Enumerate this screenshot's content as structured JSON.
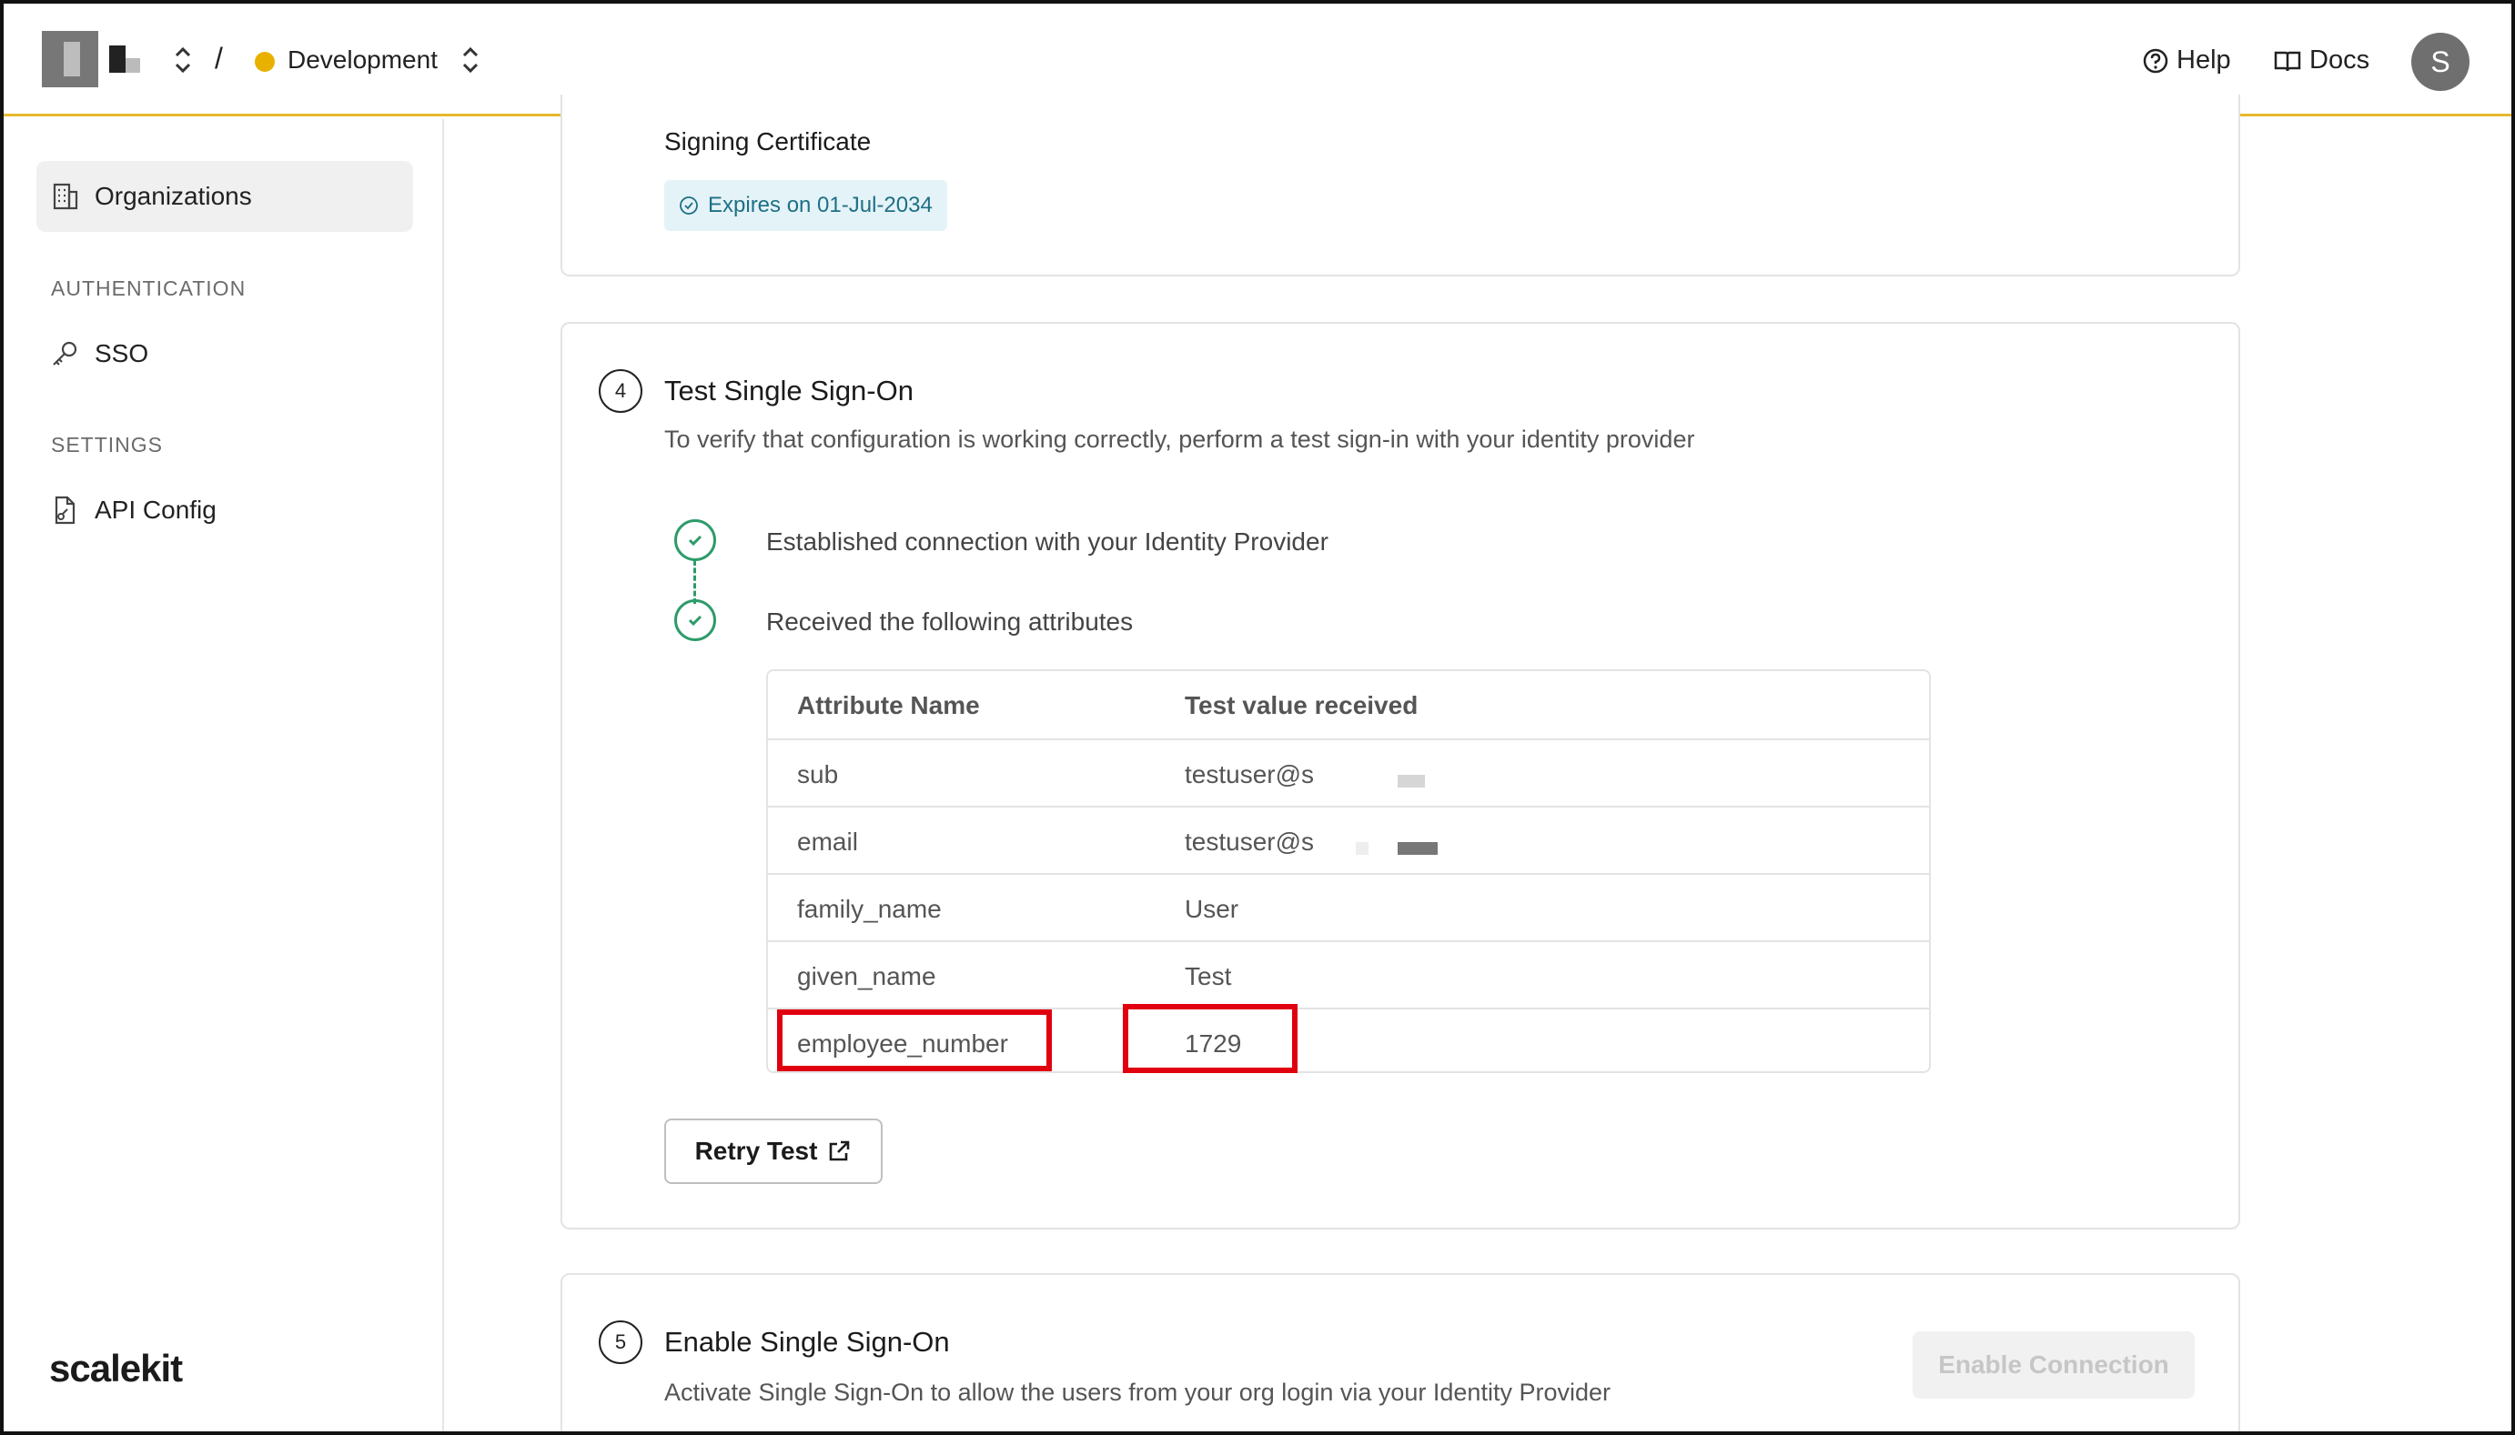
{
  "header": {
    "environment": "Development",
    "environment_color": "#e8b100",
    "help_label": "Help",
    "docs_label": "Docs",
    "avatar_initial": "S"
  },
  "sidebar": {
    "items": [
      {
        "label": "Organizations",
        "icon": "building-icon",
        "active": true
      }
    ],
    "sections": [
      {
        "label": "AUTHENTICATION",
        "items": [
          {
            "label": "SSO",
            "icon": "key-icon"
          }
        ]
      },
      {
        "label": "SETTINGS",
        "items": [
          {
            "label": "API Config",
            "icon": "file-code-icon"
          }
        ]
      }
    ],
    "brand": "scalekit"
  },
  "signing": {
    "title": "Signing Certificate",
    "expiry": "Expires on 01-Jul-2034"
  },
  "test_sso": {
    "step": "4",
    "title": "Test Single Sign-On",
    "description": "To verify that configuration is working correctly, perform a test sign-in with your identity provider",
    "checks": [
      "Established connection with your Identity Provider",
      "Received the following attributes"
    ],
    "table": {
      "headers": [
        "Attribute Name",
        "Test value received"
      ],
      "rows": [
        [
          "sub",
          "testuser@s"
        ],
        [
          "email",
          "testuser@s"
        ],
        [
          "family_name",
          "User"
        ],
        [
          "given_name",
          "Test"
        ],
        [
          "employee_number",
          "1729"
        ]
      ]
    },
    "retry_label": "Retry Test"
  },
  "enable_sso": {
    "step": "5",
    "title": "Enable Single Sign-On",
    "description": "Activate Single Sign-On to allow the users from your org login via your Identity Provider",
    "button_label": "Enable Connection"
  },
  "colors": {
    "accent_border": "#e8b92c",
    "success": "#2e9b6a",
    "highlight": "#e0000f"
  }
}
